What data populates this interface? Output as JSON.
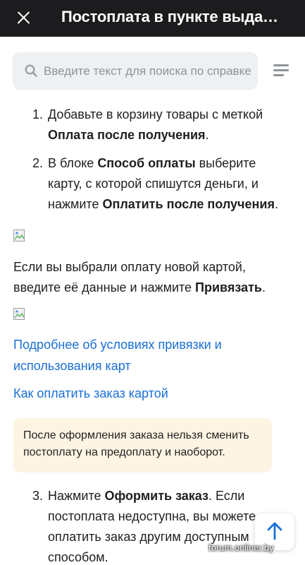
{
  "header": {
    "title": "Постоплата в пункте выда…",
    "close_icon": "close-icon"
  },
  "search": {
    "placeholder": "Введите текст для поиска по справке",
    "value": ""
  },
  "menu_icon": "menu-icon",
  "steps": [
    {
      "number": "1.",
      "line1": "Добавьте в корзину товары с меткой",
      "bold1": "Оплата после получения",
      "tail1": "."
    },
    {
      "number": "2.",
      "pre": "В блоке ",
      "bold1": "Способ оплаты",
      "mid": " выберите карту, с которой спишутся деньги, и нажмите ",
      "bold2": "Оплатить после получения",
      "tail": "."
    },
    {
      "number": "3.",
      "pre": "Нажмите ",
      "bold1": "Оформить заказ",
      "mid": ". Если постоплата недоступна, вы можете оплатить заказ другим доступным способом."
    }
  ],
  "new_card_para": {
    "pre": "Если вы выбрали оплату новой картой, введите её данные и нажмите ",
    "bold": "Привязать",
    "tail": "."
  },
  "links": [
    "Подробнее об условиях привязки и использования карт",
    "Как оплатить заказ картой"
  ],
  "note": "После оформления заказа нельзя сменить постоплату на предоплату и наоборот.",
  "scroll_top_icon": "arrow-up-icon",
  "watermark": "forum.onliner.by",
  "colors": {
    "header_bg": "#1c1c1e",
    "link": "#1a6fd6",
    "note_bg": "#fdf4e3",
    "search_bg": "#eef0f3"
  }
}
